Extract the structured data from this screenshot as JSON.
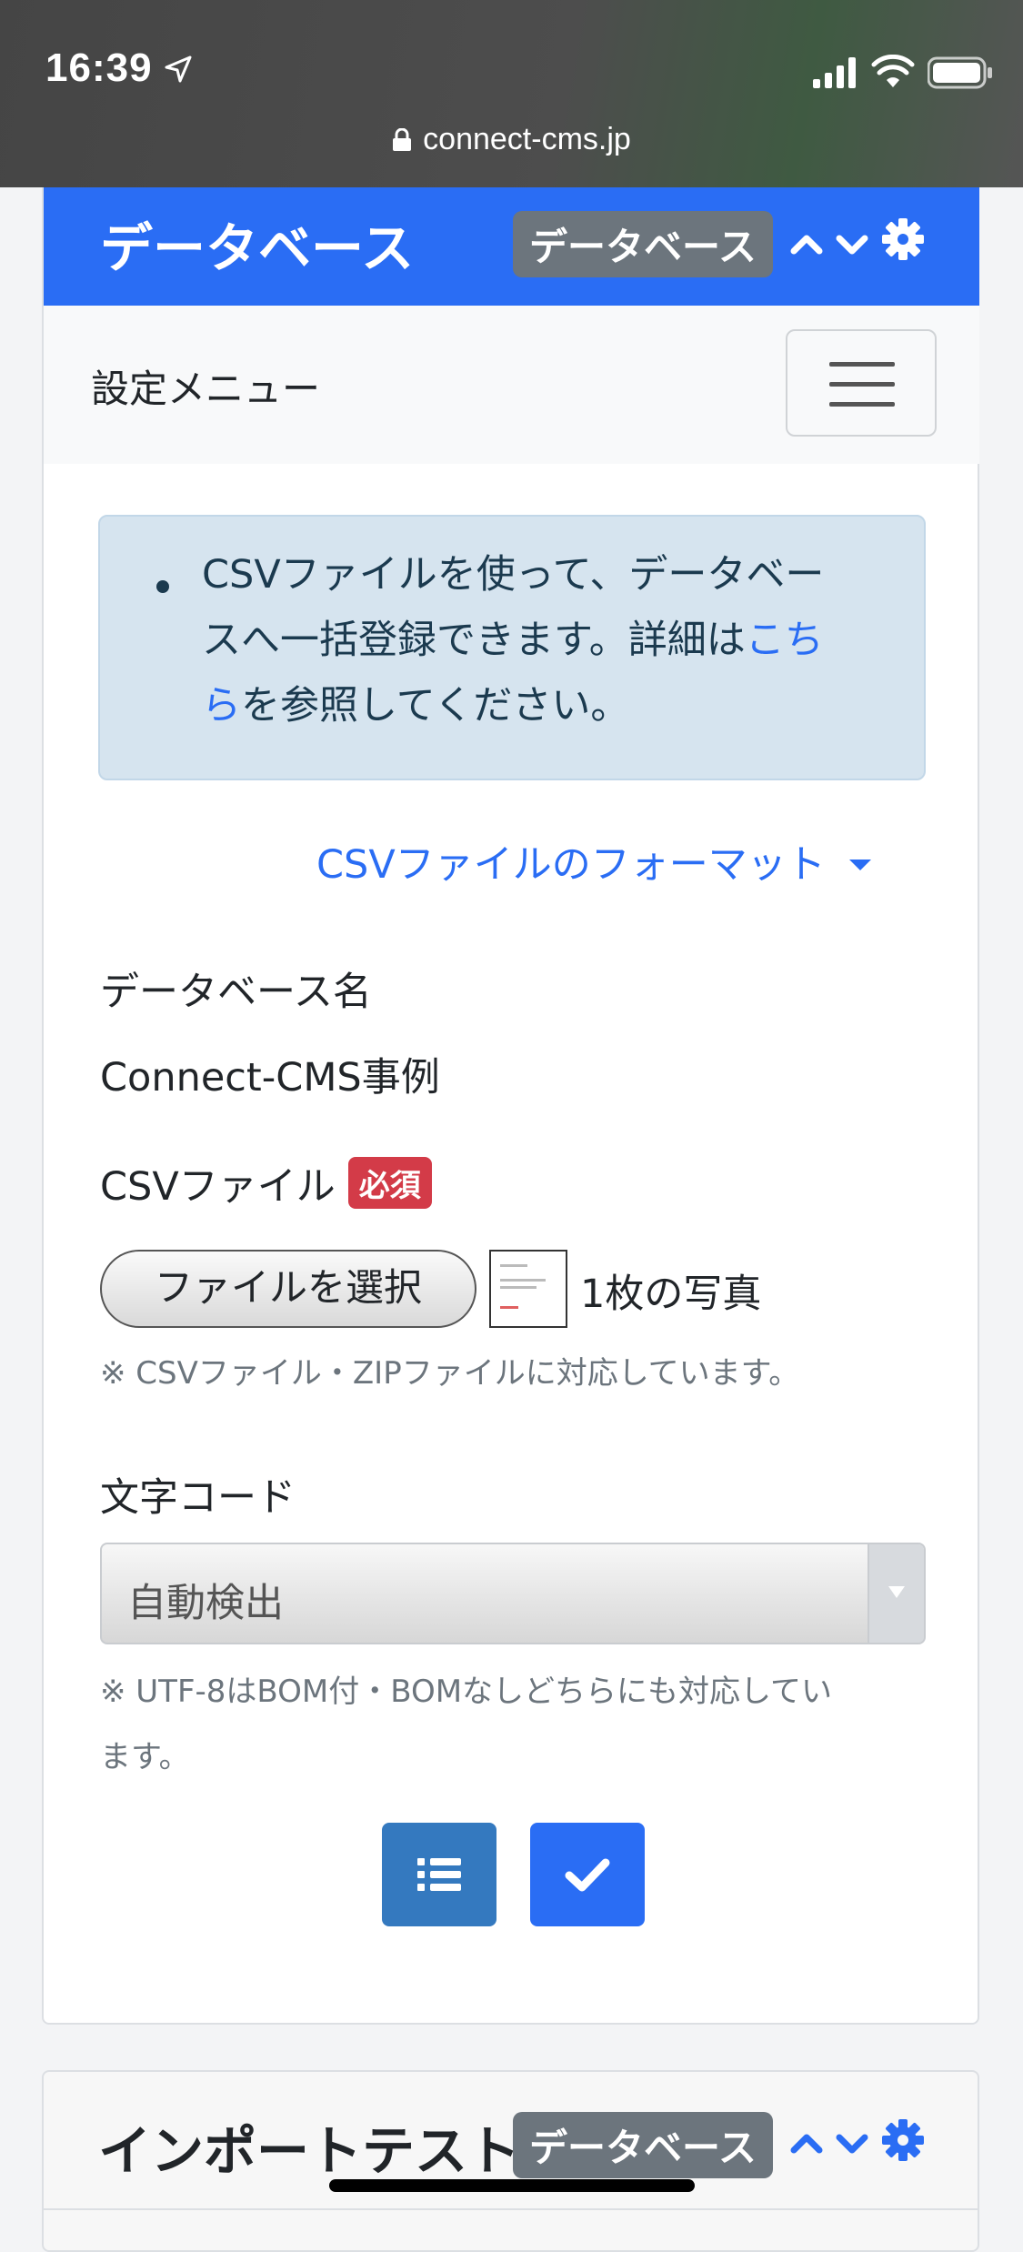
{
  "status_bar": {
    "time": "16:39"
  },
  "browser": {
    "url": "connect-cms.jp"
  },
  "frame": {
    "title": "データベース",
    "plugin_badge": "データベース",
    "settings_menu_label": "設定メニュー"
  },
  "info": {
    "text_before": "CSVファイルを使って、データベースへ一括登録できます。詳細は",
    "link": "こちら",
    "text_after": "を参照してください。"
  },
  "format_toggle": "CSVファイルのフォーマット",
  "form": {
    "db_name_label": "データベース名",
    "db_name_value": "Connect-CMS事例",
    "csv_label": "CSVファイル",
    "required_badge": "必須",
    "file_button": "ファイルを選択",
    "file_selected": "1枚の写真",
    "csv_help": "※ CSVファイル・ZIPファイルに対応しています。",
    "encoding_label": "文字コード",
    "encoding_value": "自動検出",
    "encoding_help_1": "※ UTF-8はBOM付・BOMなしどちらにも対応してい",
    "encoding_help_2": "ます。"
  },
  "next_frame": {
    "title": "インポートテスト",
    "plugin_badge": "データベース"
  },
  "icons": [
    "location-arrow-icon",
    "signal-icon",
    "wifi-icon",
    "battery-icon",
    "lock-icon",
    "chevron-up-icon",
    "chevron-down-icon",
    "gear-icon",
    "list-icon",
    "check-icon",
    "caret-down-icon"
  ],
  "colors": {
    "primary": "#2a6df4",
    "info_bg": "#d6e4ef",
    "required": "#d33b48",
    "badge": "#6c757d"
  }
}
